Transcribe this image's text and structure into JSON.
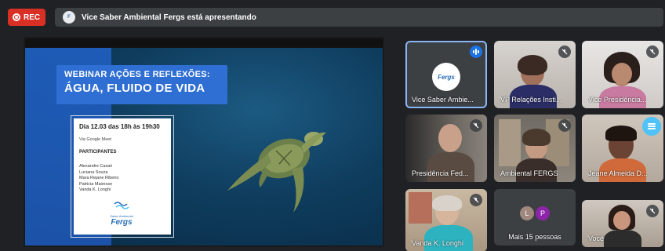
{
  "recording": {
    "label": "REC"
  },
  "presenting_bar": {
    "text": "Vice Saber Ambiental Fergs está apresentando"
  },
  "slide": {
    "title_line1": "WEBINAR AÇÕES E REFLEXÕES:",
    "title_line2": "ÁGUA, FLUIDO DE VIDA",
    "date": "Dia 12.03 das 18h às 19h30",
    "via": "Via Google Meet",
    "participants_label": "PARTICIPANTES",
    "participants": [
      "Alexandre Casari",
      "Luciana Souza",
      "Mara Rejane Ribeiro",
      "Patricia Mairesse",
      "Vanda K. Longhi"
    ],
    "logo_small": "Saber Ambiental",
    "logo_text": "Fergs"
  },
  "tiles": [
    {
      "name": "Vice Saber Ambie...",
      "status": "speaking"
    },
    {
      "name": "VP Relações Insti...",
      "status": "muted"
    },
    {
      "name": "Vice Presidência...",
      "status": "muted"
    },
    {
      "name": "Presidência Fed...",
      "status": "muted"
    },
    {
      "name": "Ambiental FERGS",
      "status": "muted"
    },
    {
      "name": "Jeane Almeida D...",
      "status": "muted"
    },
    {
      "name": "Vanda K. Longhi",
      "status": "muted"
    },
    {
      "name": "Mais 15 pessoas",
      "avatars": [
        "L",
        "P"
      ]
    },
    {
      "name": "Você",
      "status": "muted"
    }
  ],
  "colors": {
    "accent": "#8ab4f8",
    "rec": "#d93025",
    "avatar_l": "#a1887f",
    "avatar_p": "#8e24aa"
  }
}
